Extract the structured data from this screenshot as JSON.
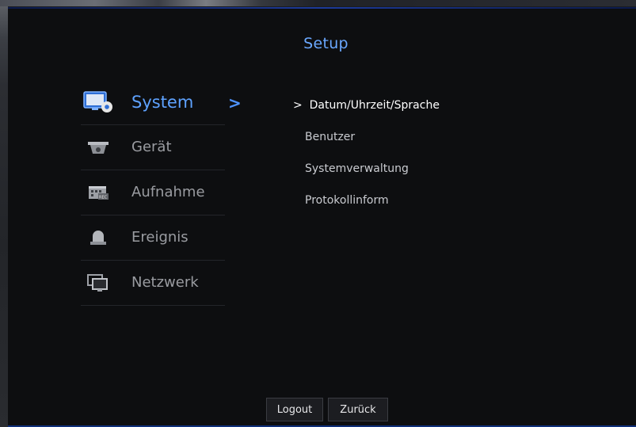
{
  "header": {
    "title": "Setup"
  },
  "menu": {
    "items": [
      {
        "label": "System",
        "icon": "monitor-gear-icon",
        "active": true
      },
      {
        "label": "Gerät",
        "icon": "dome-camera-icon",
        "active": false
      },
      {
        "label": "Aufnahme",
        "icon": "rec-calendar-icon",
        "active": false
      },
      {
        "label": "Ereignis",
        "icon": "alarm-bell-icon",
        "active": false
      },
      {
        "label": "Netzwerk",
        "icon": "network-monitors-icon",
        "active": false
      }
    ],
    "active_arrow": ">"
  },
  "submenu": {
    "items": [
      {
        "label": "Datum/Uhrzeit/Sprache",
        "marker": ">",
        "active": true
      },
      {
        "label": "Benutzer",
        "active": false
      },
      {
        "label": "Systemverwaltung",
        "active": false
      },
      {
        "label": "Protokollinform",
        "active": false
      }
    ]
  },
  "footer": {
    "logout_label": "Logout",
    "back_label": "Zurück"
  },
  "colors": {
    "accent": "#5ea2ff",
    "panel_bg": "#0d0e10",
    "text": "#9a9ca1"
  }
}
